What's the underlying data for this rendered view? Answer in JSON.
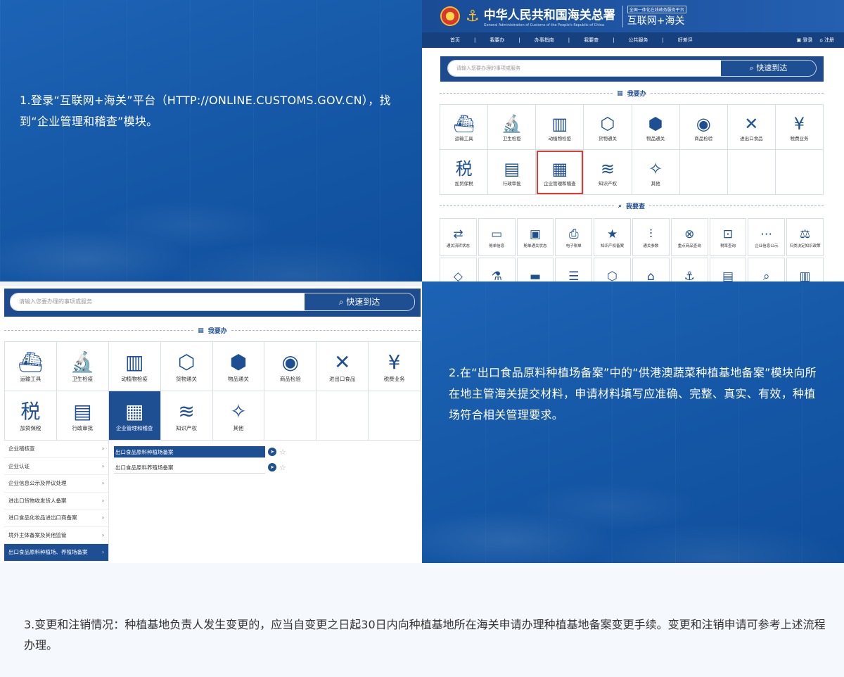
{
  "steps": {
    "step1": "1.登录“互联网+海关”平台（HTTP://ONLINE.CUSTOMS.GOV.CN），找到“企业管理和稽查”模块。",
    "step2": "2.在“出口食品原料种植场备案”中的“供港澳蔬菜种植基地备案”模块向所在地主管海关提交材料，申请材料填写应准确、完整、真实、有效，种植场符合相关管理要求。",
    "step3": "3.变更和注销情况：种植基地负责人发生变更的，应当自变更之日起30日内向种植基地所在海关申请办理种植基地备案变更手续。变更和注销申请可参考上述流程办理。"
  },
  "site": {
    "title": "中华人民共和国海关总署",
    "subtitle": "General Administration of Customs of the People's Republic of China",
    "portal_tag": "全国一体化在线政务服务平台",
    "portal_name": "互联网+海关",
    "nav": [
      "首页",
      "|",
      "我要办",
      "|",
      "办事指南",
      "|",
      "我要查",
      "|",
      "公共服务",
      "|",
      "好差评"
    ],
    "login": "登录",
    "register": "注册"
  },
  "search": {
    "placeholder": "请输入您要办理的事项或服务",
    "button": "快速到达"
  },
  "dividers": {
    "ban": "我要办",
    "cha": "我要查"
  },
  "ban_tiles": [
    {
      "icon": "ship-icon",
      "glyph": "⛴",
      "label": "运输工具"
    },
    {
      "icon": "microscope-icon",
      "glyph": "🔬",
      "label": "卫生检疫"
    },
    {
      "icon": "barrels-icon",
      "glyph": "▥",
      "label": "动植物检疫"
    },
    {
      "icon": "cargo-box-icon",
      "glyph": "⬡",
      "label": "货物通关"
    },
    {
      "icon": "cube-icon",
      "glyph": "⬢",
      "label": "物品通关"
    },
    {
      "icon": "eye-icon",
      "glyph": "◉",
      "label": "商品检验"
    },
    {
      "icon": "fork-knife-icon",
      "glyph": "✕",
      "label": "进出口食品"
    },
    {
      "icon": "yuan-hand-icon",
      "glyph": "¥",
      "label": "税费业务"
    },
    {
      "icon": "tax-icon",
      "glyph": "税",
      "label": "加贸保税"
    },
    {
      "icon": "approval-icon",
      "glyph": "▤",
      "label": "行政审批"
    },
    {
      "icon": "building-icon",
      "glyph": "▦",
      "label": "企业管理和稽查"
    },
    {
      "icon": "books-icon",
      "glyph": "≋",
      "label": "知识产权"
    },
    {
      "icon": "pin-icon",
      "glyph": "✧",
      "label": "其他"
    }
  ],
  "cha_tiles": [
    {
      "icon": "transfer-icon",
      "glyph": "⇄",
      "label": "通关流转状态"
    },
    {
      "icon": "manifest-icon",
      "glyph": "▭",
      "label": "舱单信息"
    },
    {
      "icon": "manifest-status-icon",
      "glyph": "▣",
      "label": "舱单通关状态"
    },
    {
      "icon": "printer-icon",
      "glyph": "⎙",
      "label": "电子税单"
    },
    {
      "icon": "certificate-icon",
      "glyph": "★",
      "label": "知识产权备案"
    },
    {
      "icon": "sliders-icon",
      "glyph": "⫶",
      "label": "通关参数"
    },
    {
      "icon": "search-goods-icon",
      "glyph": "⊗",
      "label": "重点商品查询"
    },
    {
      "icon": "tax-rate-icon",
      "glyph": "⊡",
      "label": "税率查询"
    },
    {
      "icon": "chat-icon",
      "glyph": "⋯",
      "label": "企业信息公示"
    },
    {
      "icon": "gavel-icon",
      "glyph": "⚖",
      "label": "归类决定知识政策"
    },
    {
      "icon": "handshake-icon",
      "glyph": "◇",
      "label": ""
    },
    {
      "icon": "flask-icon",
      "glyph": "⚗",
      "label": ""
    },
    {
      "icon": "ruler-icon",
      "glyph": "▬",
      "label": ""
    },
    {
      "icon": "list-icon",
      "glyph": "☰",
      "label": ""
    },
    {
      "icon": "package-icon",
      "glyph": "⬡",
      "label": ""
    },
    {
      "icon": "shop-icon",
      "glyph": "⌂",
      "label": ""
    },
    {
      "icon": "anchor-icon",
      "glyph": "⚓",
      "label": ""
    },
    {
      "icon": "document-icon",
      "glyph": "▤",
      "label": ""
    },
    {
      "icon": "magnifier-icon",
      "glyph": "⌕",
      "label": ""
    },
    {
      "icon": "columns-icon",
      "glyph": "▥",
      "label": ""
    }
  ],
  "menu": [
    "企业稽核查",
    "企业认证",
    "企业信息公示及异议处理",
    "进出口货物收发货人备案",
    "进口食品化妆品进出口商备案",
    "境外主体备案及其他监管",
    "出口食品原料种植场、养殖场备案"
  ],
  "sublist": [
    "出口食品原料种植场备案",
    "出口食品原料养殖场备案"
  ],
  "colors": {
    "primary": "#1f4f93",
    "highlight": "#e03a33",
    "panel_blue": "#1659a8"
  }
}
